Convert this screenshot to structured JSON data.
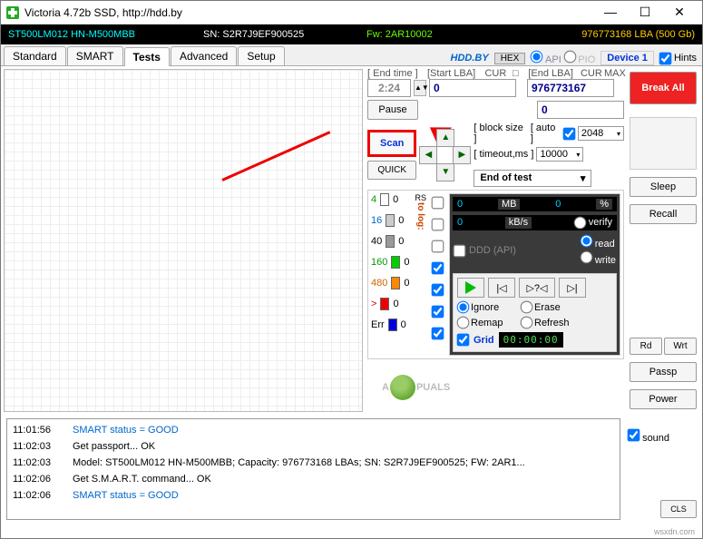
{
  "window": {
    "title": "Victoria 4.72b SSD, http://hdd.by"
  },
  "status": {
    "model": "ST500LM012 HN-M500MBB",
    "sn": "SN: S2R7J9EF900525",
    "fw": "Fw: 2AR10002",
    "lba": "976773168 LBA (500 Gb)"
  },
  "tabs": [
    "Standard",
    "SMART",
    "Tests",
    "Advanced",
    "Setup"
  ],
  "tabrow": {
    "hddby": "HDD.BY",
    "hex": "HEX",
    "api": "API",
    "pio": "PIO",
    "device": "Device 1",
    "hints": "Hints"
  },
  "scan": {
    "endtime_label": "[ End time ]",
    "startlba_label": "[Start LBA]",
    "cur": "CUR",
    "endlba_label": "[End LBA]",
    "max": "MAX",
    "endtime": "2:24",
    "startlba": "0",
    "endlba": "976773167",
    "jump": "0",
    "pause": "Pause",
    "scan": "Scan",
    "quick": "QUICK",
    "blocksize_label": "[ block size ]",
    "auto_label": "[ auto ]",
    "blocksize": "2048",
    "timeout_label": "[ timeout,ms ]",
    "timeout": "10000",
    "endtest": "End of test"
  },
  "latency": {
    "l4": "4",
    "l16": "16",
    "l40": "40",
    "l160": "160",
    "l480": "480",
    "gt": ">",
    "err": "Err",
    "c4": "0",
    "c16": "0",
    "c40": "0",
    "c160": "0",
    "c480": "0",
    "cgt": "0",
    "cerr": "0",
    "tolog": "to log:",
    "rs": "RS"
  },
  "stats": {
    "mb_val": "0",
    "mb_unit": "MB",
    "pct_val": "0",
    "pct_unit": "%",
    "kb_val": "0",
    "kb_unit": "kB/s",
    "ddd": "DDD (API)",
    "verify": "verify",
    "read": "read",
    "write": "write"
  },
  "controls": {
    "ignore": "Ignore",
    "erase": "Erase",
    "remap": "Remap",
    "refresh": "Refresh",
    "grid": "Grid",
    "time": "00:00:00",
    "rewind": "|◁",
    "back": "◁|",
    "ffwd": "▷?◁",
    "end": "▷|"
  },
  "right": {
    "break": "Break All",
    "sleep": "Sleep",
    "recall": "Recall",
    "rd": "Rd",
    "wrt": "Wrt",
    "passp": "Passp",
    "power": "Power",
    "sound": "sound",
    "cls": "CLS"
  },
  "log": [
    {
      "t": "11:01:56",
      "m": "SMART status = GOOD",
      "good": true
    },
    {
      "t": "11:02:03",
      "m": "Get passport... OK"
    },
    {
      "t": "11:02:03",
      "m": "Model: ST500LM012 HN-M500MBB; Capacity: 976773168 LBAs; SN: S2R7J9EF900525; FW: 2AR1..."
    },
    {
      "t": "11:02:06",
      "m": "Get S.M.A.R.T. command... OK"
    },
    {
      "t": "11:02:06",
      "m": "SMART status = GOOD",
      "good": true
    }
  ],
  "footer": "wsxdn.com"
}
